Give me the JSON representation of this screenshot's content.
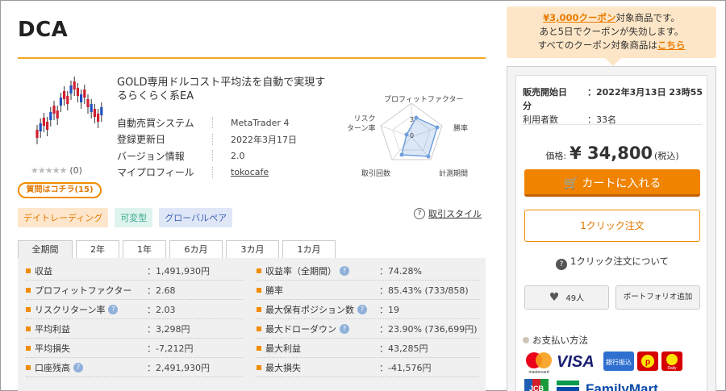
{
  "product": {
    "title": "DCA",
    "description": "GOLD専用ドルコスト平均法を自動で実現するらくらく系EA",
    "rating_stars": "★★★★★",
    "rating_count": "(0)",
    "question_button": "質問はコチラ(15)",
    "info": [
      {
        "label": "自動売買システム",
        "value": "MetaTrader 4"
      },
      {
        "label": "登録更新日",
        "value": "2022年3月17日"
      },
      {
        "label": "バージョン情報",
        "value": "2.0"
      },
      {
        "label": "マイプロフィール",
        "value": "tokocafe"
      }
    ],
    "tags": [
      "デイトレーディング",
      "可変型",
      "グローバルペア"
    ],
    "style_link": "取引スタイル"
  },
  "radar": {
    "labels": {
      "profit_factor": "プロフィットファクター",
      "win_rate": "勝率",
      "measurement_period": "計測期間",
      "trade_count": "取引回数",
      "risk_return": "リスク\nターン率"
    },
    "ticks": [
      "3",
      "0"
    ]
  },
  "period_tabs": [
    "全期間",
    "2年",
    "1年",
    "6カ月",
    "3カ月",
    "1カ月"
  ],
  "stats": {
    "left": [
      {
        "label": "収益",
        "value": "：1,491,930円",
        "help": false
      },
      {
        "label": "プロフィットファクター",
        "value": "：2.68",
        "help": false
      },
      {
        "label": "リスクリターン率",
        "value": "：2.03",
        "help": true
      },
      {
        "label": "平均利益",
        "value": "：3,298円",
        "help": false
      },
      {
        "label": "平均損失",
        "value": "：-7,212円",
        "help": false
      },
      {
        "label": "口座残高",
        "value": "：2,491,930円",
        "help": true
      }
    ],
    "right": [
      {
        "label": "収益率（全期間）",
        "value": "：74.28%",
        "help": true
      },
      {
        "label": "勝率",
        "value": "：85.43% (733/858)",
        "help": false
      },
      {
        "label": "最大保有ポジション数",
        "value": "：19",
        "help": true
      },
      {
        "label": "最大ドローダウン",
        "value": "：23.90% (736,699円)",
        "help": true
      },
      {
        "label": "最大利益",
        "value": "：43,285円",
        "help": false
      },
      {
        "label": "最大損失",
        "value": "：-41,576円",
        "help": false
      }
    ]
  },
  "coupon": {
    "amount": "¥3,000クーポン",
    "line1_suffix": "対象商品です。",
    "line2": "あと5日でクーポンが失効します。",
    "line3_prefix": "すべてのクーポン対象商品は",
    "line3_link": "こちら"
  },
  "sidebar": {
    "release_label": "販売開始日",
    "release_value": "：2022年3月13日 23時55分",
    "users_label": "利用者数",
    "users_value": "：33名",
    "price_label": "価格:",
    "price_value": "¥ 34,800",
    "price_tax": "(税込)",
    "cart_button": "カートに入れる",
    "one_click_button": "1クリック注文",
    "one_click_about": "1クリック注文について",
    "favorite_count": "49人",
    "portfolio_button": "ポートフォリオ追加",
    "payment_title": "お支払い方法",
    "payment_logos": [
      "mastercard",
      "VISA",
      "銀行振込",
      "楽天ペイ",
      "Rakuten",
      "JCB",
      "FamilyMart"
    ]
  },
  "colors": {
    "accent": "#f08300",
    "coupon_bg": "#fde6c7",
    "help_icon": "#8fb0da"
  }
}
